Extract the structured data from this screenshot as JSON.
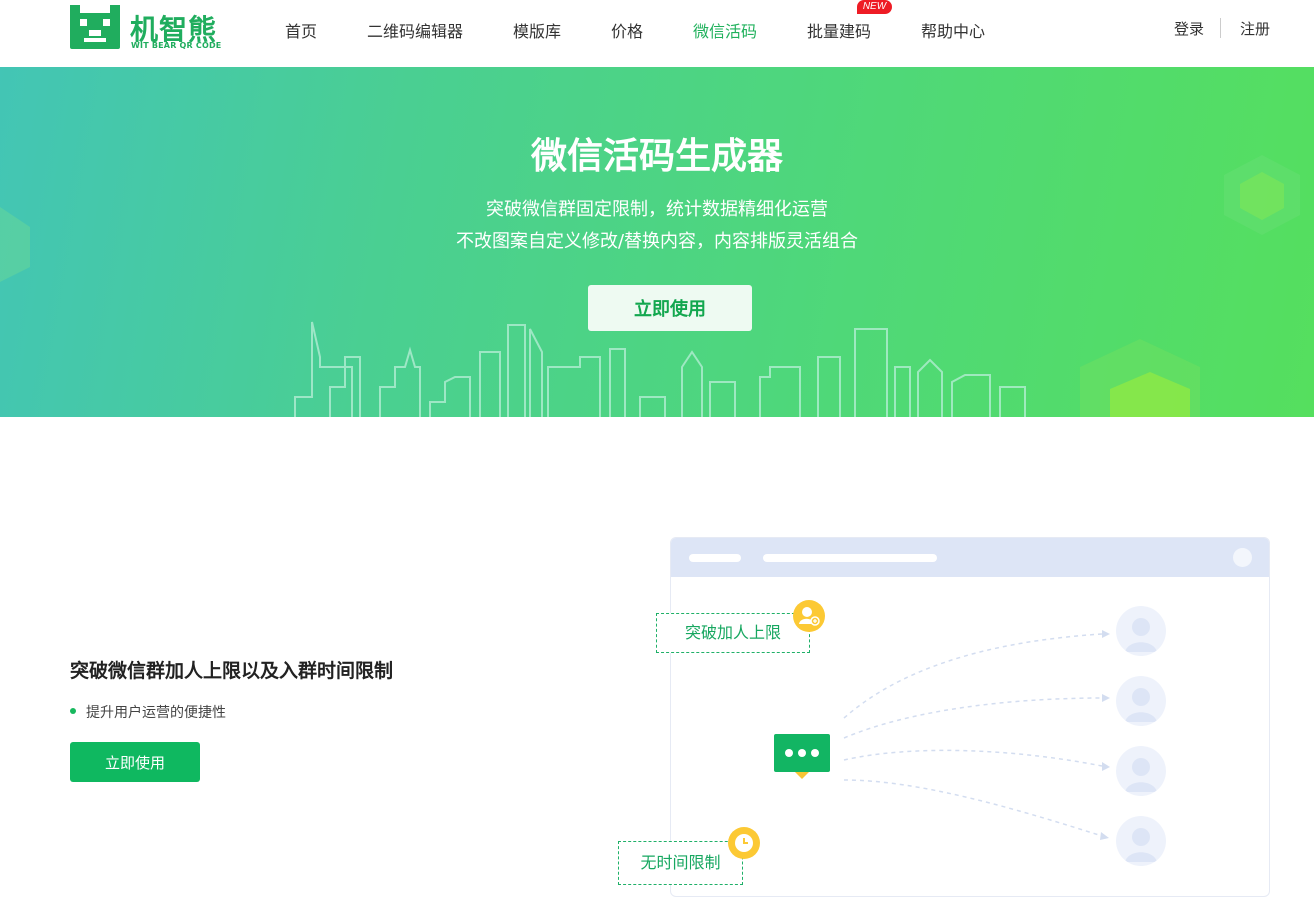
{
  "brand": {
    "name": "机智熊",
    "subtitle": "WIT BEAR QR CODE",
    "color": "#20ad5e"
  },
  "nav": {
    "items": [
      {
        "label": "首页",
        "active": false
      },
      {
        "label": "二维码编辑器",
        "active": false
      },
      {
        "label": "模版库",
        "active": false
      },
      {
        "label": "价格",
        "active": false
      },
      {
        "label": "微信活码",
        "active": true
      },
      {
        "label": "批量建码",
        "active": false
      },
      {
        "label": "帮助中心",
        "active": false
      }
    ],
    "new_badge": "NEW",
    "active_color": "#20b15c"
  },
  "auth": {
    "login": "登录",
    "register": "注册"
  },
  "hero": {
    "title": "微信活码生成器",
    "subtitle_line1": "突破微信群固定限制，统计数据精细化运营",
    "subtitle_line2": "不改图案自定义修改/替换内容，内容排版灵活组合",
    "cta": "立即使用"
  },
  "feature": {
    "title": "突破微信群加人上限以及入群时间限制",
    "bullet": "提升用户运营的便捷性",
    "cta": "立即使用",
    "accent": "#0fb860"
  },
  "illustration": {
    "tag_limit": "突破加人上限",
    "tag_time": "无时间限制",
    "icons": [
      "chat-bubble-icon",
      "user-add-icon",
      "clock-icon",
      "user-avatar-icon"
    ]
  }
}
